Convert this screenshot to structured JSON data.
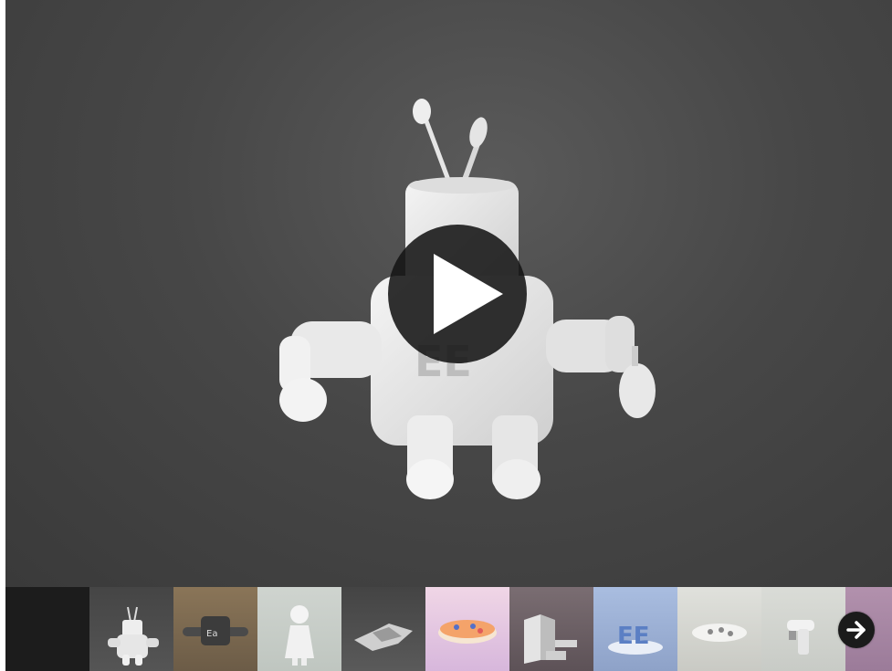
{
  "viewer": {
    "model_icon": "robot-model",
    "play_icon": "play-icon"
  },
  "thumbnails": [
    {
      "icon": "blank",
      "bg": "#1c1c1c"
    },
    {
      "icon": "robot-thumbnail",
      "bg": "#4a4a4a"
    },
    {
      "icon": "device-thumbnail",
      "bg": "#7d6a50"
    },
    {
      "icon": "doll-thumbnail",
      "bg": "#c9cfc9"
    },
    {
      "icon": "star-shape-thumbnail",
      "bg": "#4e4e4e"
    },
    {
      "icon": "cake-thumbnail",
      "bg": "#e6c6dc"
    },
    {
      "icon": "stairs-thumbnail",
      "bg": "#6e6266"
    },
    {
      "icon": "letters-thumbnail",
      "bg": "#9fb2d6"
    },
    {
      "icon": "disc-thumbnail",
      "bg": "#d9dad4"
    },
    {
      "icon": "faucet-thumbnail",
      "bg": "#d4d7d2"
    },
    {
      "icon": "partial-thumbnail",
      "bg": "#a98aa6"
    }
  ],
  "navigation": {
    "next_icon": "arrow-right-icon"
  }
}
